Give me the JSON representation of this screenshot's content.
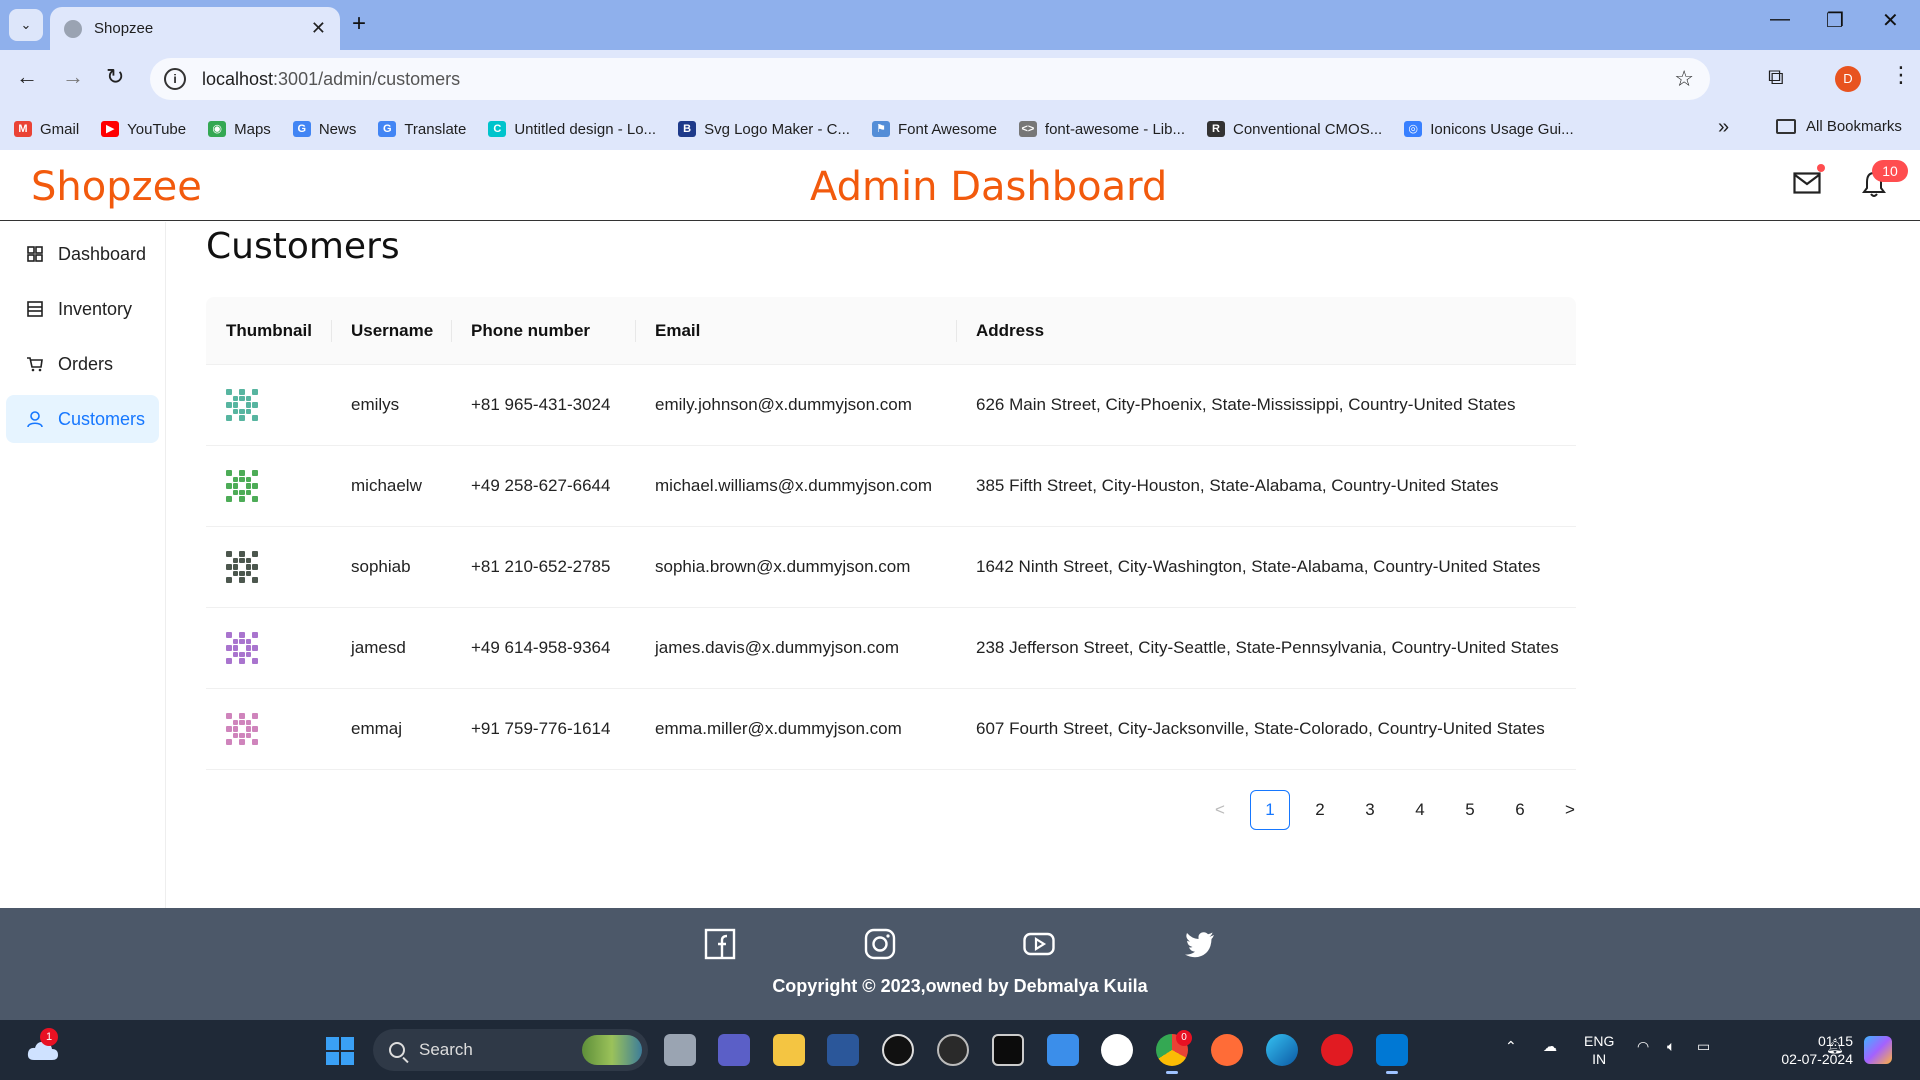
{
  "browser": {
    "tab_title": "Shopzee",
    "url_host": "localhost",
    "url_path": ":3001/admin/customers",
    "profile_initial": "D",
    "bookmarks": [
      {
        "label": "Gmail",
        "color": "#ea4335",
        "glyph": "M"
      },
      {
        "label": "YouTube",
        "color": "#ff0000",
        "glyph": "▶"
      },
      {
        "label": "Maps",
        "color": "#34a853",
        "glyph": "◉"
      },
      {
        "label": "News",
        "color": "#4285f4",
        "glyph": "G"
      },
      {
        "label": "Translate",
        "color": "#4285f4",
        "glyph": "G"
      },
      {
        "label": "Untitled design - Lo...",
        "color": "#00c4cc",
        "glyph": "C"
      },
      {
        "label": "Svg Logo Maker - C...",
        "color": "#1e3a8a",
        "glyph": "B"
      },
      {
        "label": "Font Awesome",
        "color": "#538dd7",
        "glyph": "⚑"
      },
      {
        "label": "font-awesome - Lib...",
        "color": "#777777",
        "glyph": "<>"
      },
      {
        "label": "Conventional CMOS...",
        "color": "#333333",
        "glyph": "R"
      },
      {
        "label": "Ionicons Usage Gui...",
        "color": "#3880ff",
        "glyph": "◎"
      }
    ],
    "all_bookmarks": "All Bookmarks"
  },
  "header": {
    "brand": "Shopzee",
    "title": "Admin Dashboard",
    "notification_count": "10"
  },
  "sidebar": {
    "items": [
      {
        "label": "Dashboard",
        "icon": "dashboard-icon",
        "active": false
      },
      {
        "label": "Inventory",
        "icon": "inventory-icon",
        "active": false
      },
      {
        "label": "Orders",
        "icon": "cart-icon",
        "active": false
      },
      {
        "label": "Customers",
        "icon": "user-icon",
        "active": true
      }
    ]
  },
  "main": {
    "page_title": "Customers",
    "columns": [
      "Thumbnail",
      "Username",
      "Phone number",
      "Email",
      "Address"
    ],
    "rows": [
      {
        "username": "emilys",
        "phone": "+81 965-431-3024",
        "email": "emily.johnson@x.dummyjson.com",
        "address": "626 Main Street, City-Phoenix, State-Mississippi, Country-United States",
        "thumb_color": "#3aa88f"
      },
      {
        "username": "michaelw",
        "phone": "+49 258-627-6644",
        "email": "michael.williams@x.dummyjson.com",
        "address": "385 Fifth Street, City-Houston, State-Alabama, Country-United States",
        "thumb_color": "#2e9e3a"
      },
      {
        "username": "sophiab",
        "phone": "+81 210-652-2785",
        "email": "sophia.brown@x.dummyjson.com",
        "address": "1642 Ninth Street, City-Washington, State-Alabama, Country-United States",
        "thumb_color": "#2d3a2f"
      },
      {
        "username": "jamesd",
        "phone": "+49 614-958-9364",
        "email": "james.davis@x.dummyjson.com",
        "address": "238 Jefferson Street, City-Seattle, State-Pennsylvania, Country-United States",
        "thumb_color": "#9a5cc6"
      },
      {
        "username": "emmaj",
        "phone": "+91 759-776-1614",
        "email": "emma.miller@x.dummyjson.com",
        "address": "607 Fourth Street, City-Jacksonville, State-Colorado, Country-United States",
        "thumb_color": "#c76fb0"
      }
    ],
    "pagination": {
      "pages": [
        "1",
        "2",
        "3",
        "4",
        "5",
        "6"
      ],
      "current": "1",
      "prev": "<",
      "next": ">"
    }
  },
  "footer": {
    "copyright": "Copyright © 2023,owned by Debmalya Kuila",
    "social": [
      "facebook-icon",
      "instagram-icon",
      "youtube-icon",
      "twitter-icon"
    ]
  },
  "taskbar": {
    "weather_badge": "1",
    "search_placeholder": "Search",
    "chrome_badge": "0",
    "lang_line1": "ENG",
    "lang_line2": "IN",
    "time": "01:15",
    "date": "02-07-2024"
  },
  "colors": {
    "brand": "#f25a0d",
    "active": "#1677ff",
    "footer_bg": "#4c5869"
  }
}
